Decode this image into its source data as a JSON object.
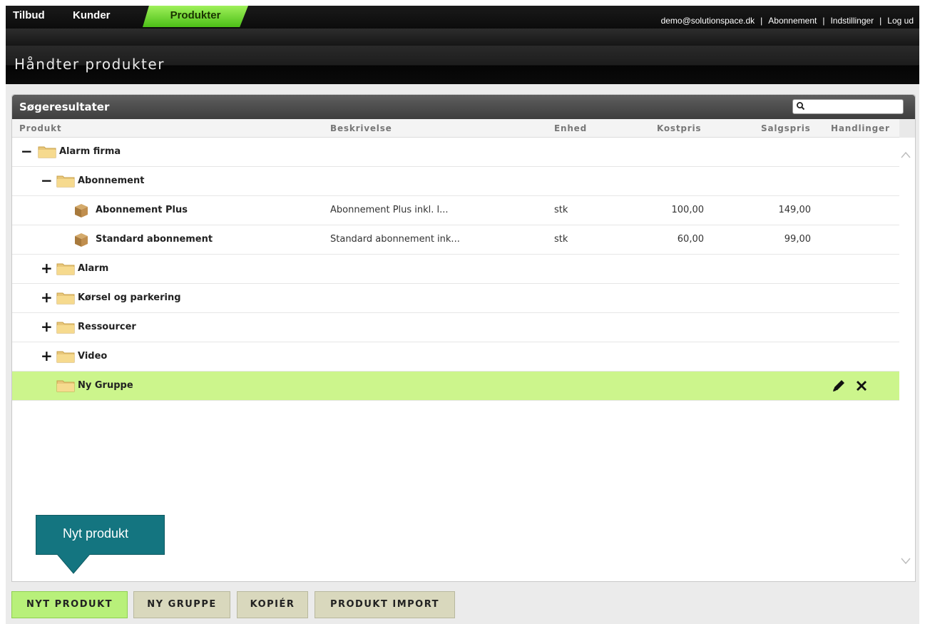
{
  "nav": {
    "tabs": [
      "Tilbud",
      "Kunder",
      "Produkter"
    ],
    "active_tab": "Produkter",
    "user_email": "demo@solutionspace.dk",
    "links": [
      "Abonnement",
      "Indstillinger",
      "Log ud"
    ],
    "separator": "|"
  },
  "page": {
    "title": "Håndter produkter"
  },
  "panel": {
    "title": "Søgeresultater",
    "search": {
      "value": "",
      "placeholder": ""
    },
    "columns": [
      "Produkt",
      "Beskrivelse",
      "Enhed",
      "Kostpris",
      "Salgspris",
      "Handlinger"
    ]
  },
  "rows": [
    {
      "name": "Alarm firma",
      "toggle": "−",
      "kind": "group",
      "level": 0
    },
    {
      "name": "Abonnement",
      "toggle": "−",
      "kind": "group",
      "level": 1
    },
    {
      "name": "Abonnement Plus",
      "kind": "product",
      "level": 2,
      "description": "Abonnement Plus inkl. l...",
      "unit": "stk",
      "cost": "100,00",
      "price": "149,00"
    },
    {
      "name": "Standard abonnement",
      "kind": "product",
      "level": 2,
      "description": "Standard abonnement ink...",
      "unit": "stk",
      "cost": "60,00",
      "price": "99,00"
    },
    {
      "name": "Alarm",
      "toggle": "+",
      "kind": "group",
      "level": 1
    },
    {
      "name": "Kørsel og parkering",
      "toggle": "+",
      "kind": "group",
      "level": 1
    },
    {
      "name": "Ressourcer",
      "toggle": "+",
      "kind": "group",
      "level": 1
    },
    {
      "name": "Video",
      "toggle": "+",
      "kind": "group",
      "level": 1
    },
    {
      "name": "Ny Gruppe",
      "kind": "group",
      "level": 1,
      "selected": true,
      "actions": [
        "pencil-icon",
        "close-x-icon"
      ]
    }
  ],
  "callout": {
    "text": "Nyt produkt"
  },
  "buttons": {
    "new_product": "NYT PRODUKT",
    "new_group": "NY GRUPPE",
    "copy": "KOPIÉR",
    "import": "PRODUKT IMPORT"
  },
  "colors": {
    "active_tab": "#6fd62f",
    "selected_row": "#ccf58c",
    "callout": "#147580",
    "primary_button": "#b8f07a",
    "secondary_button": "#d9d8bd"
  }
}
